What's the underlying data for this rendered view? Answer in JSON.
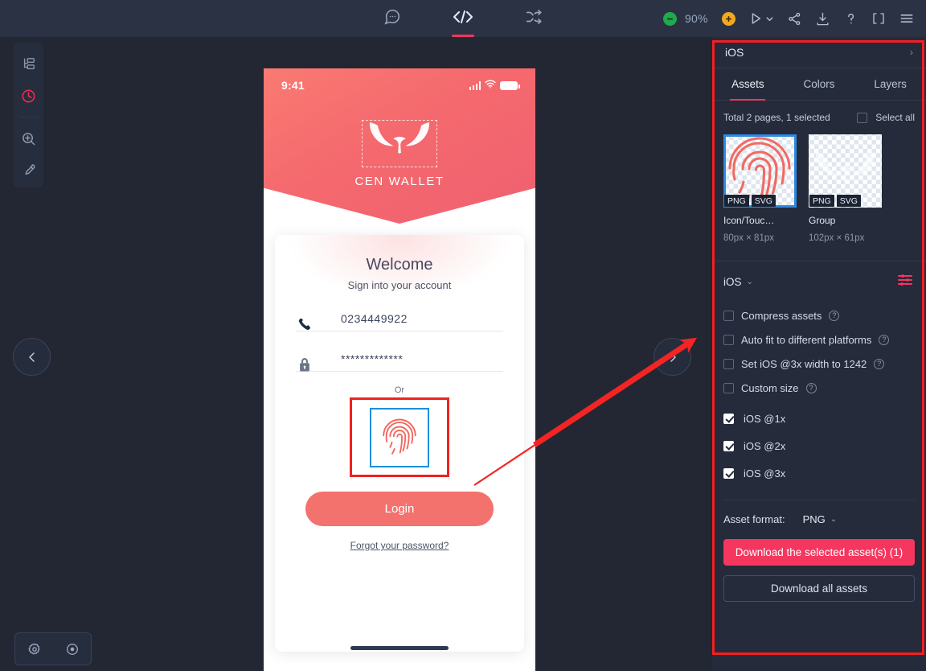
{
  "toolbar": {
    "tabs": [
      {
        "name": "comment",
        "icon": "comment-icon",
        "active": false
      },
      {
        "name": "code",
        "icon": "code-icon",
        "active": true
      },
      {
        "name": "flow",
        "icon": "shuffle-icon",
        "active": false
      }
    ],
    "zoom_level": "90%",
    "zoom_out_label": "−",
    "zoom_in_label": "+",
    "right_icons": [
      "play-icon",
      "chevron-down-icon",
      "share-icon",
      "download-icon",
      "help-icon",
      "fullscreen-icon",
      "menu-icon"
    ]
  },
  "left_rail": {
    "items": [
      {
        "name": "layers-icon",
        "active": false
      },
      {
        "name": "history-icon",
        "active": true
      },
      {
        "name": "zoom-icon",
        "active": false
      },
      {
        "name": "eyedropper-icon",
        "active": false
      }
    ]
  },
  "bottom_bar": {
    "items": [
      "gear-icon",
      "eye-icon"
    ]
  },
  "canvas": {
    "prev_label": "‹",
    "next_label": "›"
  },
  "phone": {
    "status_time": "9:41",
    "brand": "CEN WALLET",
    "welcome": "Welcome",
    "subtitle": "Sign into your account",
    "phone_value": "0234449922",
    "password_value": "*************",
    "or_label": "Or",
    "login_label": "Login",
    "forgot_label": "Forgot your password?"
  },
  "panel": {
    "header_title": "iOS",
    "header_chevron": "›",
    "tabs": [
      {
        "label": "Assets",
        "active": true
      },
      {
        "label": "Colors",
        "active": false
      },
      {
        "label": "Layers",
        "active": false
      }
    ],
    "selection_summary": "Total 2 pages, 1 selected",
    "select_all_label": "Select all",
    "select_all_checked": false,
    "assets": [
      {
        "name": "Icon/Touc…",
        "size": "80px × 81px",
        "badges": [
          "PNG",
          "SVG"
        ],
        "selected": true,
        "thumb": "fingerprint-icon"
      },
      {
        "name": "Group",
        "size": "102px × 61px",
        "badges": [
          "PNG",
          "SVG"
        ],
        "selected": false,
        "thumb": "logo-icon"
      }
    ],
    "options": {
      "platform": "iOS",
      "platform_chevron": "⌄",
      "settings_icon": "sliders-icon",
      "checkboxes": [
        {
          "label": "Compress assets",
          "checked": false,
          "help": true
        },
        {
          "label": "Auto fit to different platforms",
          "checked": false,
          "help": true
        },
        {
          "label": "Set iOS @3x width to 1242",
          "checked": false,
          "help": true
        },
        {
          "label": "Custom size",
          "checked": false,
          "help": true
        }
      ],
      "scales": [
        {
          "label": "iOS @1x",
          "checked": true
        },
        {
          "label": "iOS @2x",
          "checked": true
        },
        {
          "label": "iOS @3x",
          "checked": true
        }
      ],
      "format_label": "Asset format:",
      "format_value": "PNG",
      "format_chevron": "⌄",
      "download_selected_label": "Download the selected asset(s) (1)",
      "download_all_label": "Download all assets"
    }
  },
  "annotation": {
    "highlight_color": "#f41f21",
    "arrow_color": "#f42424"
  },
  "colors": {
    "accent_pink": "#f2365c",
    "accent_red": "#f5365f",
    "panel_bg": "#252b3a",
    "canvas_bg": "#222733",
    "topbar_bg": "#2a3244",
    "coral": "#f4726d",
    "select_blue": "#2f8ae0"
  }
}
